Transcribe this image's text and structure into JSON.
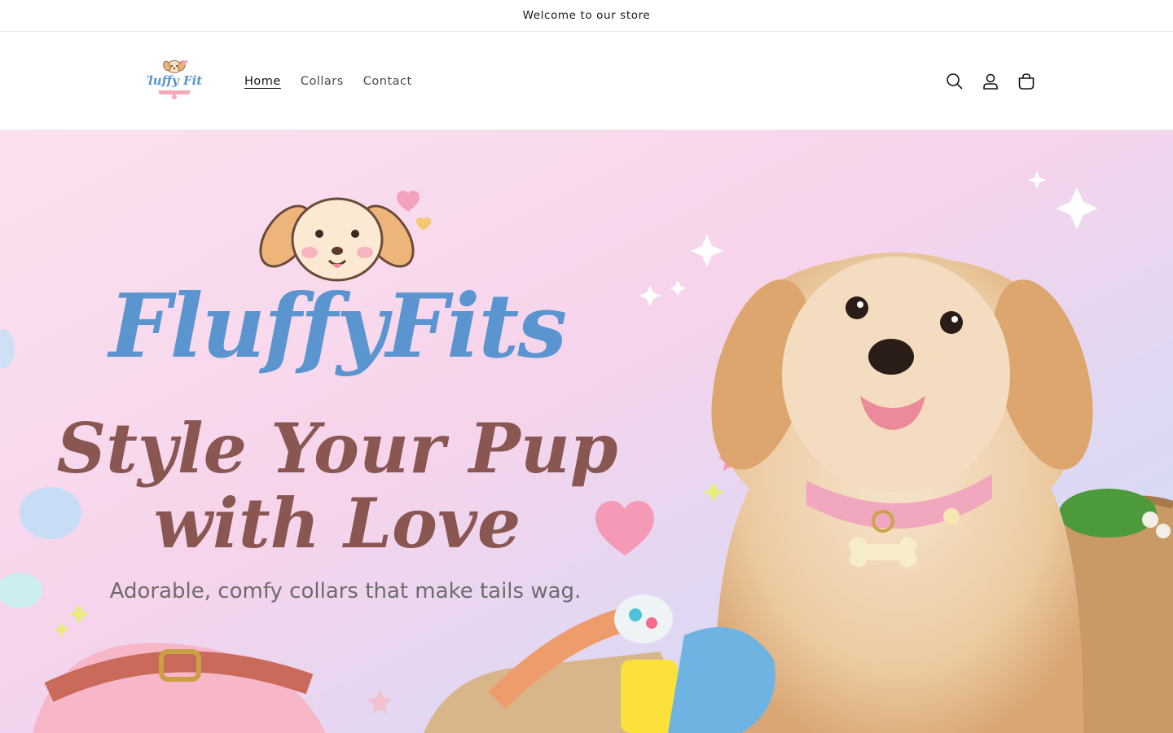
{
  "announcement": {
    "text": "Welcome to our store"
  },
  "header": {
    "logo": {
      "brand_text": "Fluffy Fits"
    },
    "nav": [
      {
        "label": "Home",
        "active": true
      },
      {
        "label": "Collars",
        "active": false
      },
      {
        "label": "Contact",
        "active": false
      }
    ],
    "icons": [
      "search-icon",
      "account-icon",
      "cart-icon"
    ]
  },
  "hero": {
    "brand_word_1": "Fluffy",
    "brand_word_2": "Fits",
    "headline_line_1": "Style Your Pup",
    "headline_line_2": "with Love",
    "tagline": "Adorable, comfy collars that make tails wag.",
    "colors": {
      "brand_blue": "#5b95cf",
      "headline_brown": "#8a5652",
      "tagline_gray": "#6f6a6e",
      "bg_pink": "#f8d4ea",
      "bg_blue": "#cfe0f6",
      "heart_pink": "#f59ab6"
    }
  }
}
